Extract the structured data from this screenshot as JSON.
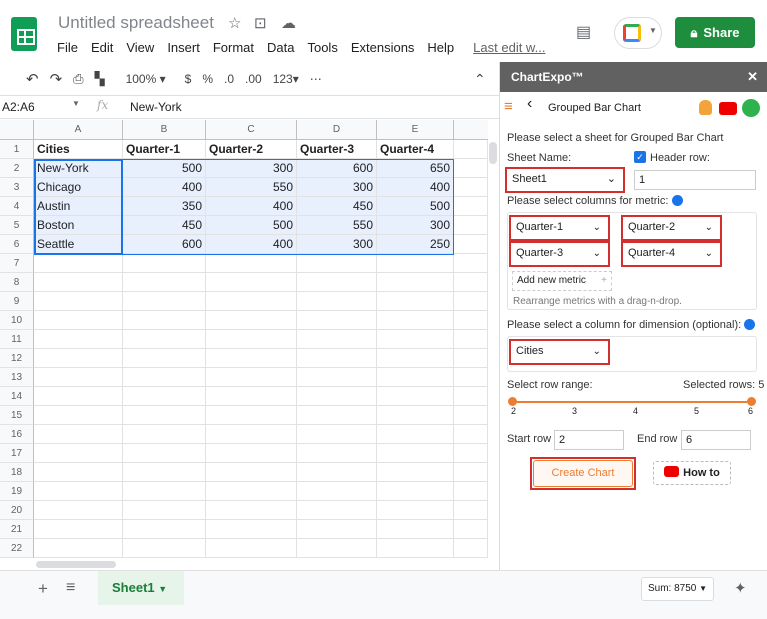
{
  "doc": {
    "title": "Untitled spreadsheet",
    "share_label": "Share",
    "last_edit": "Last edit w..."
  },
  "menu": [
    "File",
    "Edit",
    "View",
    "Insert",
    "Format",
    "Data",
    "Tools",
    "Extensions",
    "Help"
  ],
  "toolbar": {
    "zoom": "100%",
    "currency": "$",
    "percent": "%",
    "dec_less": ".0",
    "dec_more": ".00",
    "format": "123",
    "more": "⋯"
  },
  "formula": {
    "cellref": "A2:A6",
    "fx": "fx",
    "value": "New-York"
  },
  "columns": [
    "A",
    "B",
    "C",
    "D",
    "E"
  ],
  "rows": [
    "1",
    "2",
    "3",
    "4",
    "5",
    "6",
    "7",
    "8",
    "9",
    "10",
    "11",
    "12",
    "13",
    "14",
    "15",
    "16",
    "17",
    "18",
    "19",
    "20",
    "21",
    "22"
  ],
  "table": {
    "headers": [
      "Cities",
      "Quarter-1",
      "Quarter-2",
      "Quarter-3",
      "Quarter-4"
    ],
    "data": [
      [
        "New-York",
        "500",
        "300",
        "600",
        "650"
      ],
      [
        "Chicago",
        "400",
        "550",
        "300",
        "400"
      ],
      [
        "Austin",
        "350",
        "400",
        "450",
        "500"
      ],
      [
        "Boston",
        "450",
        "500",
        "550",
        "300"
      ],
      [
        "Seattle",
        "600",
        "400",
        "300",
        "250"
      ]
    ]
  },
  "sheet_tab": "Sheet1",
  "sum": "Sum: 8750",
  "panel": {
    "title": "ChartExpo™",
    "close": "✕",
    "chart_name": "Grouped Bar Chart",
    "select_sheet_prompt": "Please select a sheet for Grouped Bar Chart",
    "sheet_name_label": "Sheet Name:",
    "sheet_value": "Sheet1",
    "header_row_label": "Header row:",
    "header_row_value": "1",
    "metric_prompt": "Please select columns for metric:",
    "metrics": [
      "Quarter-1",
      "Quarter-2",
      "Quarter-3",
      "Quarter-4"
    ],
    "add_metric": "Add new metric",
    "rearrange": "Rearrange metrics with a drag-n-drop.",
    "dimension_prompt": "Please select a column for dimension (optional):",
    "dimension_value": "Cities",
    "row_range_label": "Select row range:",
    "selected_rows": "Selected rows: 5",
    "range_ticks": [
      "2",
      "3",
      "4",
      "5",
      "6"
    ],
    "start_row_label": "Start row",
    "start_row": "2",
    "end_row_label": "End row",
    "end_row": "6",
    "create_label": "Create Chart",
    "howto_label": "How to"
  }
}
